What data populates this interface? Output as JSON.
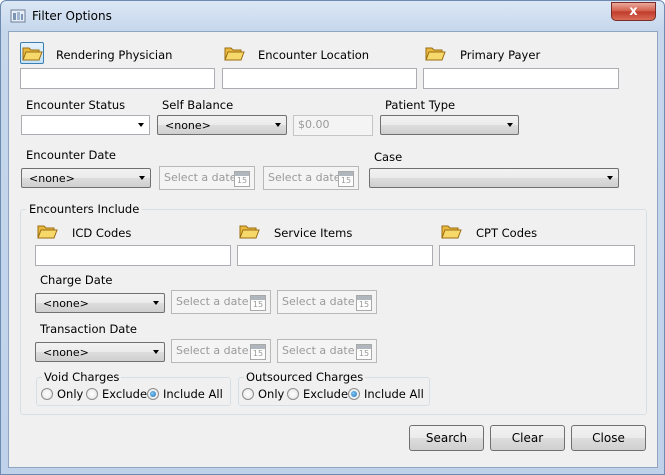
{
  "window": {
    "title": "Filter Options",
    "close_label": "x"
  },
  "top_fields": [
    {
      "label": "Rendering Physician"
    },
    {
      "label": "Encounter Location"
    },
    {
      "label": "Primary Payer"
    }
  ],
  "encounter_status": {
    "label": "Encounter Status",
    "value": ""
  },
  "self_balance": {
    "label": "Self Balance",
    "value": "<none>",
    "amount": "$0.00"
  },
  "patient_type": {
    "label": "Patient Type",
    "value": ""
  },
  "encounter_date": {
    "label": "Encounter Date",
    "value": "<none>",
    "from_placeholder": "Select a date",
    "to_placeholder": "Select a date",
    "calendar_day": "15"
  },
  "case": {
    "label": "Case",
    "value": ""
  },
  "encounters_include": {
    "label": "Encounters Include",
    "fields": [
      {
        "label": "ICD Codes"
      },
      {
        "label": "Service Items"
      },
      {
        "label": "CPT Codes"
      }
    ],
    "charge_date": {
      "label": "Charge Date",
      "value": "<none>",
      "from_placeholder": "Select a date",
      "to_placeholder": "Select a date"
    },
    "transaction_date": {
      "label": "Transaction Date",
      "value": "<none>",
      "from_placeholder": "Select a date",
      "to_placeholder": "Select a date"
    },
    "void_charges": {
      "label": "Void Charges",
      "options": [
        "Only",
        "Exclude",
        "Include All"
      ],
      "selected": "Include All"
    },
    "outsourced_charges": {
      "label": "Outsourced Charges",
      "options": [
        "Only",
        "Exclude",
        "Include All"
      ],
      "selected": "Include All"
    }
  },
  "buttons": {
    "search": "Search",
    "clear": "Clear",
    "close": "Close"
  }
}
